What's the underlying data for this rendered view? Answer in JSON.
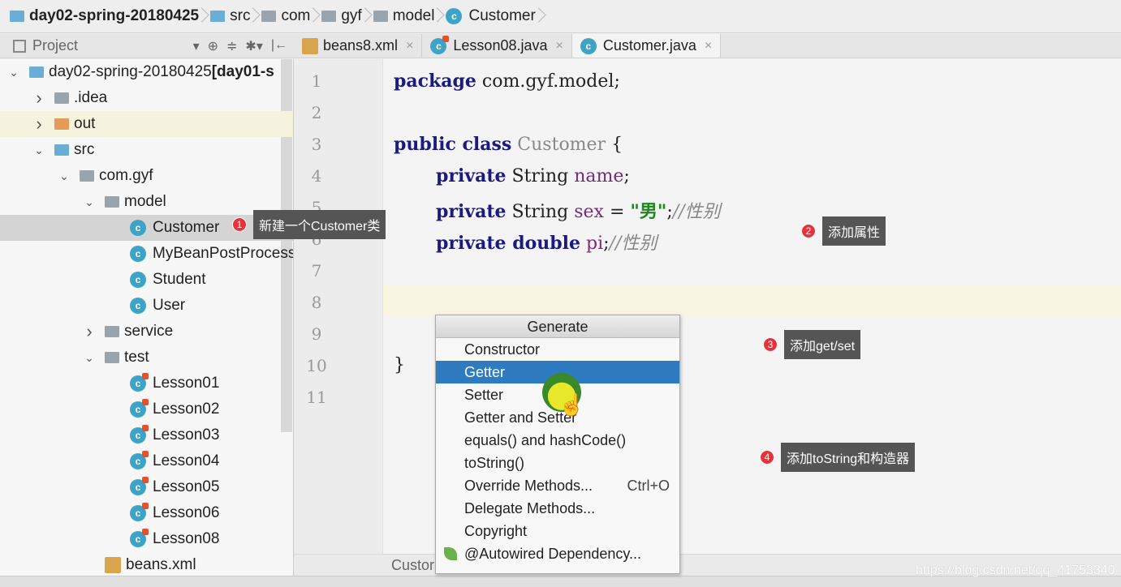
{
  "breadcrumb": [
    "day02-spring-20180425",
    "src",
    "com",
    "gyf",
    "model",
    "Customer"
  ],
  "project_panel": {
    "title": "Project"
  },
  "tabs": [
    {
      "label": "beans8.xml",
      "active": false
    },
    {
      "label": "Lesson08.java",
      "active": false
    },
    {
      "label": "Customer.java",
      "active": true
    }
  ],
  "tree": [
    {
      "label": "day02-spring-20180425",
      "suffix": "[day01-s",
      "level": 0,
      "arrow": "down",
      "icon": "module"
    },
    {
      "label": ".idea",
      "level": 1,
      "arrow": "right",
      "icon": "folder"
    },
    {
      "label": "out",
      "level": 1,
      "arrow": "right",
      "icon": "folder-orange"
    },
    {
      "label": "src",
      "level": 1,
      "arrow": "down",
      "icon": "folder-blue"
    },
    {
      "label": "com.gyf",
      "level": 2,
      "arrow": "down",
      "icon": "package"
    },
    {
      "label": "model",
      "level": 3,
      "arrow": "down",
      "icon": "package"
    },
    {
      "label": "Customer",
      "level": 4,
      "icon": "class",
      "selected": true
    },
    {
      "label": "MyBeanPostProcess",
      "level": 4,
      "icon": "class"
    },
    {
      "label": "Student",
      "level": 4,
      "icon": "class"
    },
    {
      "label": "User",
      "level": 4,
      "icon": "class"
    },
    {
      "label": "service",
      "level": 3,
      "arrow": "right",
      "icon": "package"
    },
    {
      "label": "test",
      "level": 3,
      "arrow": "down",
      "icon": "package"
    },
    {
      "label": "Lesson01",
      "level": 4,
      "icon": "test-class"
    },
    {
      "label": "Lesson02",
      "level": 4,
      "icon": "test-class"
    },
    {
      "label": "Lesson03",
      "level": 4,
      "icon": "test-class"
    },
    {
      "label": "Lesson04",
      "level": 4,
      "icon": "test-class"
    },
    {
      "label": "Lesson05",
      "level": 4,
      "icon": "test-class"
    },
    {
      "label": "Lesson06",
      "level": 4,
      "icon": "test-class"
    },
    {
      "label": "Lesson08",
      "level": 4,
      "icon": "test-class"
    },
    {
      "label": "beans.xml",
      "level": 3,
      "icon": "xml"
    }
  ],
  "code": {
    "line_numbers": [
      "1",
      "2",
      "3",
      "4",
      "5",
      "6",
      "7",
      "8",
      "9",
      "10",
      "11"
    ],
    "l1": {
      "kw": "package",
      "rest": " com.gyf.model;"
    },
    "l3": {
      "kw": "public class",
      "name": " Customer",
      "rest": " {"
    },
    "l4": {
      "kw": "private",
      "rest": " String ",
      "fld": "name",
      "end": ";"
    },
    "l5": {
      "kw": "private",
      "rest": " String ",
      "fld": "sex",
      "eq": " = ",
      "str": "\"男\"",
      "end": ";",
      "cm": "//性别"
    },
    "l6": {
      "kw": "private double",
      "rest": " ",
      "fld": "pi",
      "end": ";",
      "cm": "//性别"
    },
    "l10": "}"
  },
  "editor_footer": "Custor",
  "generate_menu": {
    "title": "Generate",
    "items": [
      {
        "label": "Constructor"
      },
      {
        "label": "Getter",
        "selected": true
      },
      {
        "label": "Setter"
      },
      {
        "label": "Getter and Setter"
      },
      {
        "label": "equals() and hashCode()"
      },
      {
        "label": "toString()"
      },
      {
        "label": "Override Methods...",
        "shortcut": "Ctrl+O"
      },
      {
        "label": "Delegate Methods..."
      },
      {
        "label": "Copyright"
      },
      {
        "label": "@Autowired Dependency...",
        "icon": "spring-leaf-icon"
      }
    ]
  },
  "annotations": [
    {
      "num": "1",
      "text": "新建一个Customer类"
    },
    {
      "num": "2",
      "text": "添加属性"
    },
    {
      "num": "3",
      "text": "添加get/set"
    },
    {
      "num": "4",
      "text": "添加toString和构造器"
    }
  ],
  "watermark": "https://blog.csdn.net/qq_41753340",
  "colors": {
    "selection": "#2f7bbf",
    "badge": "#e8323a",
    "note_bg": "#555555"
  }
}
